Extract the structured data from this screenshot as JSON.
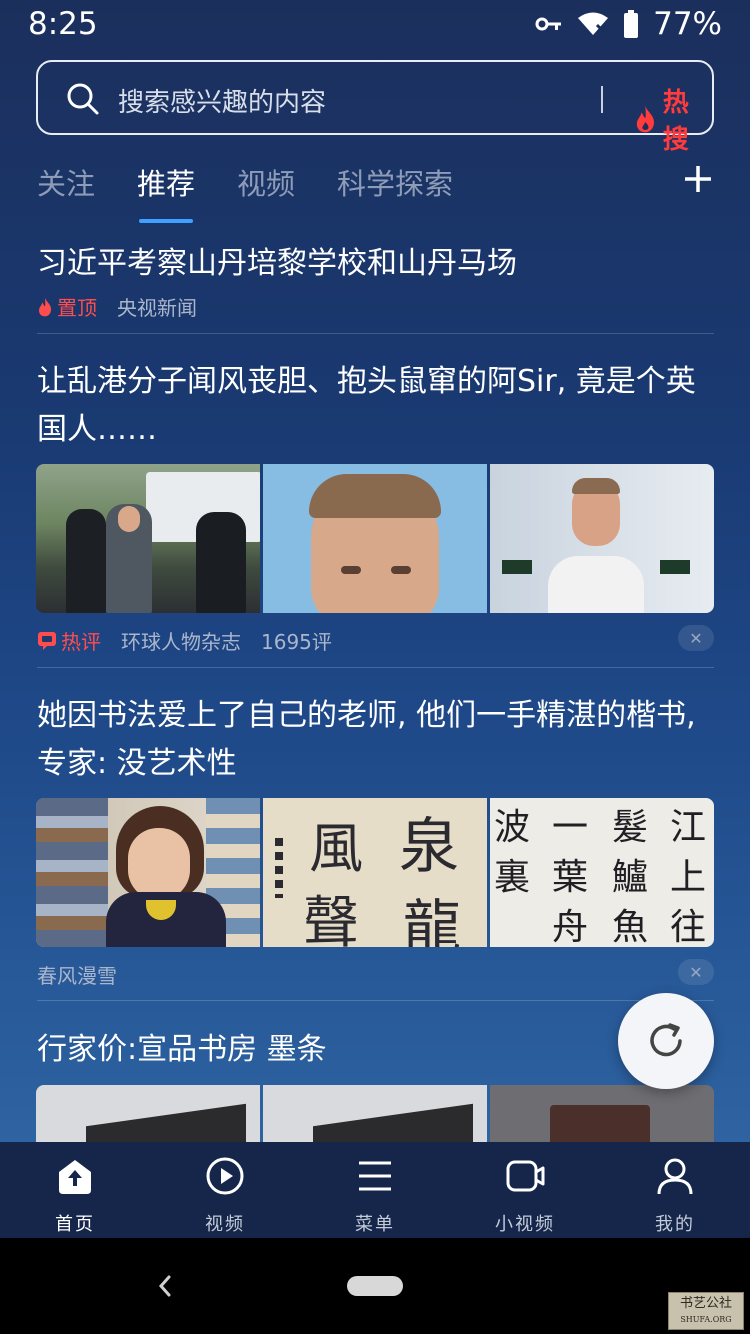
{
  "status_bar": {
    "time": "8:25",
    "battery_pct": "77%"
  },
  "search": {
    "placeholder": "搜索感兴趣的内容",
    "hot_label": "热搜",
    "icon": "search-icon"
  },
  "tabs": [
    {
      "label": "关注",
      "active": false
    },
    {
      "label": "推荐",
      "active": true
    },
    {
      "label": "视频",
      "active": false
    },
    {
      "label": "科学探索",
      "active": false
    }
  ],
  "feed": [
    {
      "title": "习近平考察山丹培黎学校和山丹马场",
      "tag": "置顶",
      "source": "央视新闻"
    },
    {
      "title": "让乱港分子闻风丧胆、抱头鼠窜的阿Sir, 竟是个英国人……",
      "tag": "热评",
      "source": "环球人物杂志",
      "comments": "1695评"
    },
    {
      "title": "她因书法爱上了自己的老师, 他们一手精湛的楷书, 专家: 没艺术性",
      "source": "春风漫雪",
      "calligraphy": [
        "風",
        "泉",
        "聲",
        "龍",
        "波",
        "一",
        "髮",
        "江",
        "裏",
        "葉",
        "鱸",
        "上",
        "舟",
        "魚",
        "往"
      ]
    },
    {
      "title": "行家价:宣品书房 墨条"
    }
  ],
  "bottom_nav": [
    {
      "label": "首页",
      "icon": "home-icon",
      "active": true
    },
    {
      "label": "视频",
      "icon": "play-icon",
      "active": false
    },
    {
      "label": "菜单",
      "icon": "menu-icon",
      "active": false
    },
    {
      "label": "小视频",
      "icon": "camera-icon",
      "active": false
    },
    {
      "label": "我的",
      "icon": "profile-icon",
      "active": false
    }
  ],
  "watermark": {
    "line1": "书艺公社",
    "line2": "SHUFA.ORG"
  },
  "colors": {
    "accent": "#3ea0ff",
    "hot": "#ff3b3b",
    "nav_bg": "#16264a"
  }
}
